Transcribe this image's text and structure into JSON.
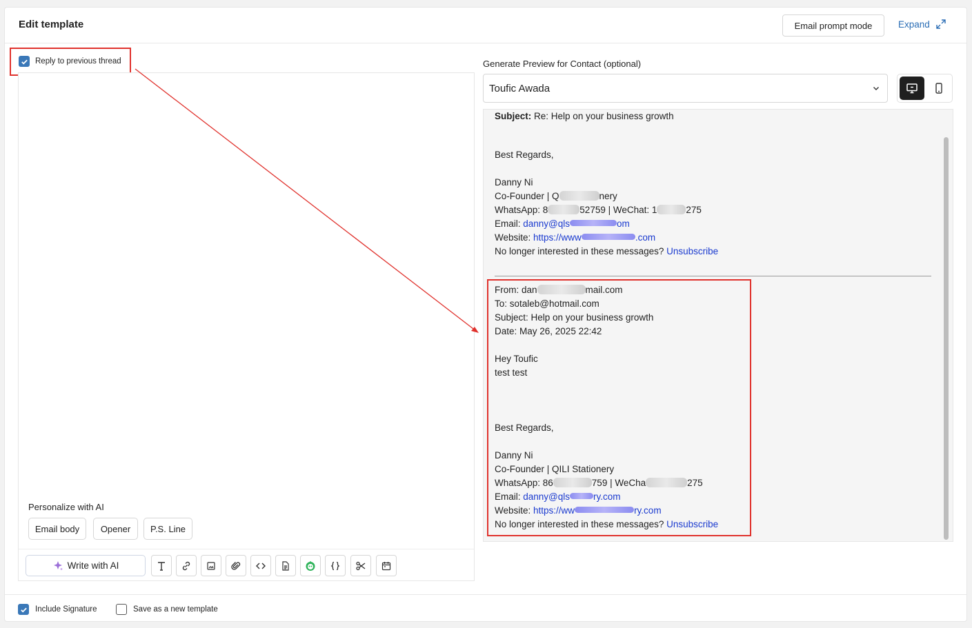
{
  "header": {
    "title": "Edit template",
    "prompt_mode_label": "Email prompt mode",
    "expand_label": "Expand"
  },
  "reply": {
    "label": "Reply to previous thread",
    "checked": true
  },
  "editor": {
    "personalize_label": "Personalize with AI",
    "chips": [
      "Email body",
      "Opener",
      "P.S. Line"
    ],
    "write_ai_label": "Write with AI",
    "toolbar_icons": [
      "text-format-icon",
      "link-icon",
      "image-icon",
      "attachment-icon",
      "code-icon",
      "document-icon",
      "bot-icon",
      "variable-braces-icon",
      "scissors-icon",
      "calendar-icon"
    ]
  },
  "preview": {
    "label": "Generate Preview for Contact (optional)",
    "selected_contact": "Toufic Awada",
    "subject_label": "Subject:",
    "subject": "Re: Help on your business growth",
    "sig1": {
      "regards": "Best Regards,",
      "name": "Danny Ni",
      "role_prefix": "Co-Founder | Q",
      "role_suffix": "nery",
      "whatsapp_prefix": "WhatsApp: 8",
      "whatsapp_mid": "52759 | WeChat: 1",
      "whatsapp_suffix": "275",
      "email_prefix": "Email: ",
      "email_link_a": "danny@qls",
      "email_link_b": "om",
      "website_prefix": "Website: ",
      "website_link_a": "https://www",
      "website_link_b": ".com",
      "unsub_text": "No longer interested in these messages? ",
      "unsub_link": "Unsubscribe"
    },
    "quoted": {
      "from_a": "From: dan",
      "from_b": "mail.com",
      "to": "To: sotaleb@hotmail.com",
      "subject": "Subject: Help on your business growth",
      "date": "Date: May 26, 2025 22:42",
      "greeting": "Hey Toufic",
      "body": "test test",
      "regards": "Best Regards,",
      "name": "Danny Ni",
      "role": "Co-Founder | QILI Stationery",
      "whatsapp_a": "WhatsApp: 86",
      "whatsapp_b": "759 | WeCha",
      "whatsapp_c": "275",
      "email_prefix": "Email: ",
      "email_link_a": "danny@qls",
      "email_link_b": "ry.com",
      "website_prefix": "Website: ",
      "website_link_a": "https://ww",
      "website_link_b": "ry.com",
      "unsub_text": "No longer interested in these messages? ",
      "unsub_link": "Unsubscribe"
    }
  },
  "footer": {
    "include_signature_label": "Include Signature",
    "include_signature_checked": true,
    "save_template_label": "Save as a new template",
    "save_template_checked": false
  },
  "colors": {
    "accent": "#3a78b8",
    "link": "#1a3acf",
    "annotation": "#e0312c"
  }
}
